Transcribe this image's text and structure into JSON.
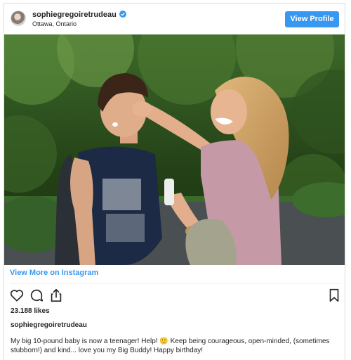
{
  "post": {
    "username": "sophiegregoiretrudeau",
    "location": "Ottawa, Ontario",
    "view_profile_label": "View Profile",
    "view_more_label": "View More on Instagram",
    "likes": "23.188 likes",
    "caption_user": "sophiegregoiretrudeau",
    "caption_text": "My big 10-pound baby is now a teenager! Help! 🙂 Keep being courageous, open-minded, (sometimes stubborn!) and kind... love you my Big Buddy! Happy birthday!"
  },
  "icons": {
    "verified": "verified-badge-icon",
    "like": "heart-icon",
    "comment": "comment-icon",
    "share": "share-icon",
    "save": "bookmark-icon"
  },
  "colors": {
    "accent": "#3897f0",
    "text": "#262626",
    "border": "#dbdbdb"
  }
}
